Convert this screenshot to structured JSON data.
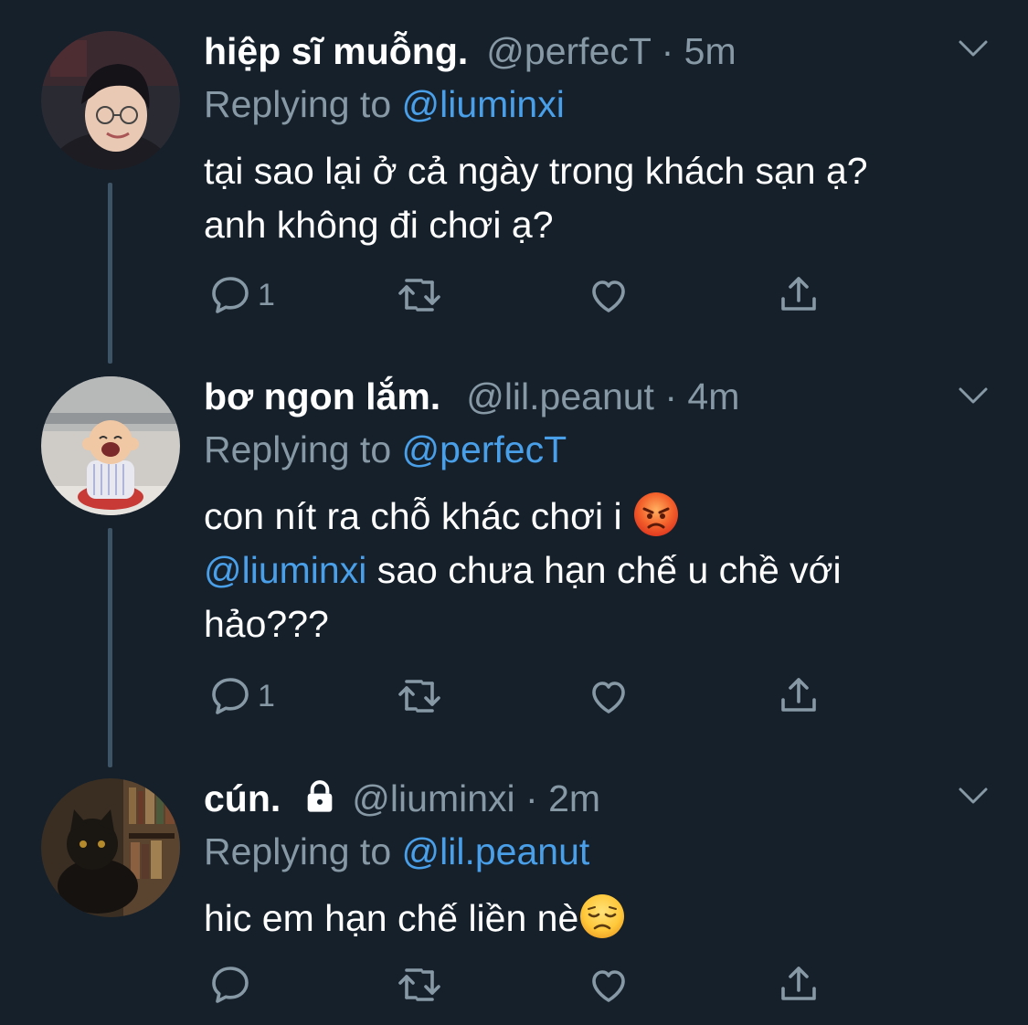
{
  "tweets": [
    {
      "display_name": "hiệp sĩ muỗng.",
      "handle": "@perfecT",
      "separator": "·",
      "time": "5m",
      "replying_prefix": "Replying to",
      "replying_to": "@liuminxi",
      "body_line_1": "tại sao lại ở cả ngày trong khách sạn ạ?",
      "body_line_2": "anh không đi chơi ạ?",
      "reply_count": "1",
      "avatar_icon": "avatar-person-glasses"
    },
    {
      "display_name": "bơ ngon lắm.",
      "handle": "@lil.peanut",
      "separator": "·",
      "time": "4m",
      "replying_prefix": "Replying to",
      "replying_to": "@perfecT",
      "body_line_1": "con nít ra chỗ khác chơi i",
      "body_line_1_emoji": "angry-face-emoji",
      "body_line_2_mention": "@liuminxi",
      "body_line_2": " sao chưa hạn chế u chề với",
      "body_line_3": "hảo???",
      "reply_count": "1",
      "avatar_icon": "avatar-laughing-child"
    },
    {
      "display_name": "cún.",
      "protected_icon": "lock-icon",
      "handle": "@liuminxi",
      "separator": "·",
      "time": "2m",
      "replying_prefix": "Replying to",
      "replying_to": "@lil.peanut",
      "body_line_1": "hic em hạn chế liền nè",
      "body_line_1_emoji": "disappointed-face-emoji",
      "reply_count": "",
      "avatar_icon": "avatar-black-cat"
    }
  ],
  "colors": {
    "background": "#15202b",
    "text": "#ffffff",
    "secondary": "#8899a6",
    "link": "#4a9fe9",
    "thread_line": "#3d5466"
  },
  "icons": [
    "reply-icon",
    "retweet-icon",
    "like-icon",
    "share-icon",
    "chevron-down-icon",
    "lock-icon"
  ]
}
